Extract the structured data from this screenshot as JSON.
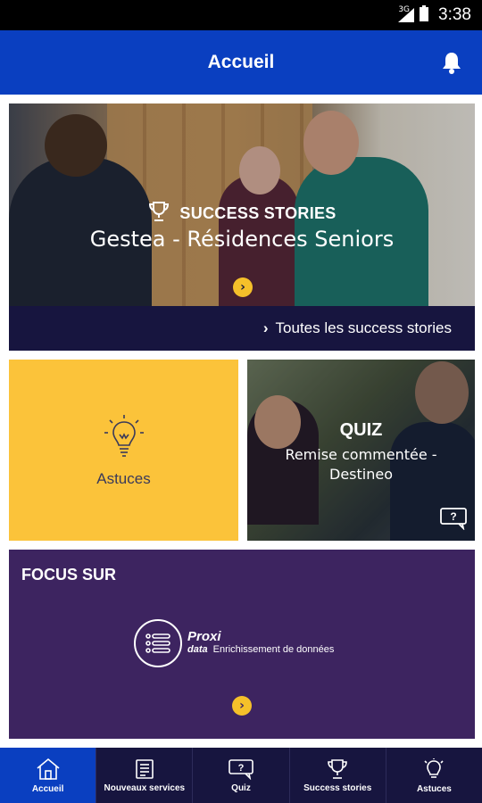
{
  "status_bar": {
    "network": "3G",
    "time": "3:38"
  },
  "app_bar": {
    "title": "Accueil",
    "icon": "bell-icon"
  },
  "hero": {
    "kicker": "SUCCESS STORIES",
    "title": "Gestea - Résidences Seniors",
    "icon": "trophy-icon",
    "link_label": "Toutes les success stories"
  },
  "tips_tile": {
    "label": "Astuces",
    "icon": "lightbulb-icon"
  },
  "quiz_tile": {
    "title": "QUIZ",
    "subtitle": "Remise commentée - Destineo",
    "icon": "question-bubble-icon"
  },
  "focus": {
    "title": "FOCUS SUR",
    "brand_name": "Proxi",
    "brand_sub": "data",
    "brand_tagline": "Enrichissement de données"
  },
  "bottom_nav": {
    "items": [
      {
        "label": "Accueil",
        "icon": "home-icon",
        "active": true
      },
      {
        "label": "Nouveaux services",
        "icon": "newspaper-icon",
        "active": false
      },
      {
        "label": "Quiz",
        "icon": "question-bubble-icon",
        "active": false
      },
      {
        "label": "Success stories",
        "icon": "trophy-icon",
        "active": false
      },
      {
        "label": "Astuces",
        "icon": "lightbulb-icon",
        "active": false
      }
    ]
  },
  "colors": {
    "primary": "#0a3fc0",
    "navy": "#17153f",
    "yellow": "#fbc33a",
    "purple": "#3d2460"
  }
}
